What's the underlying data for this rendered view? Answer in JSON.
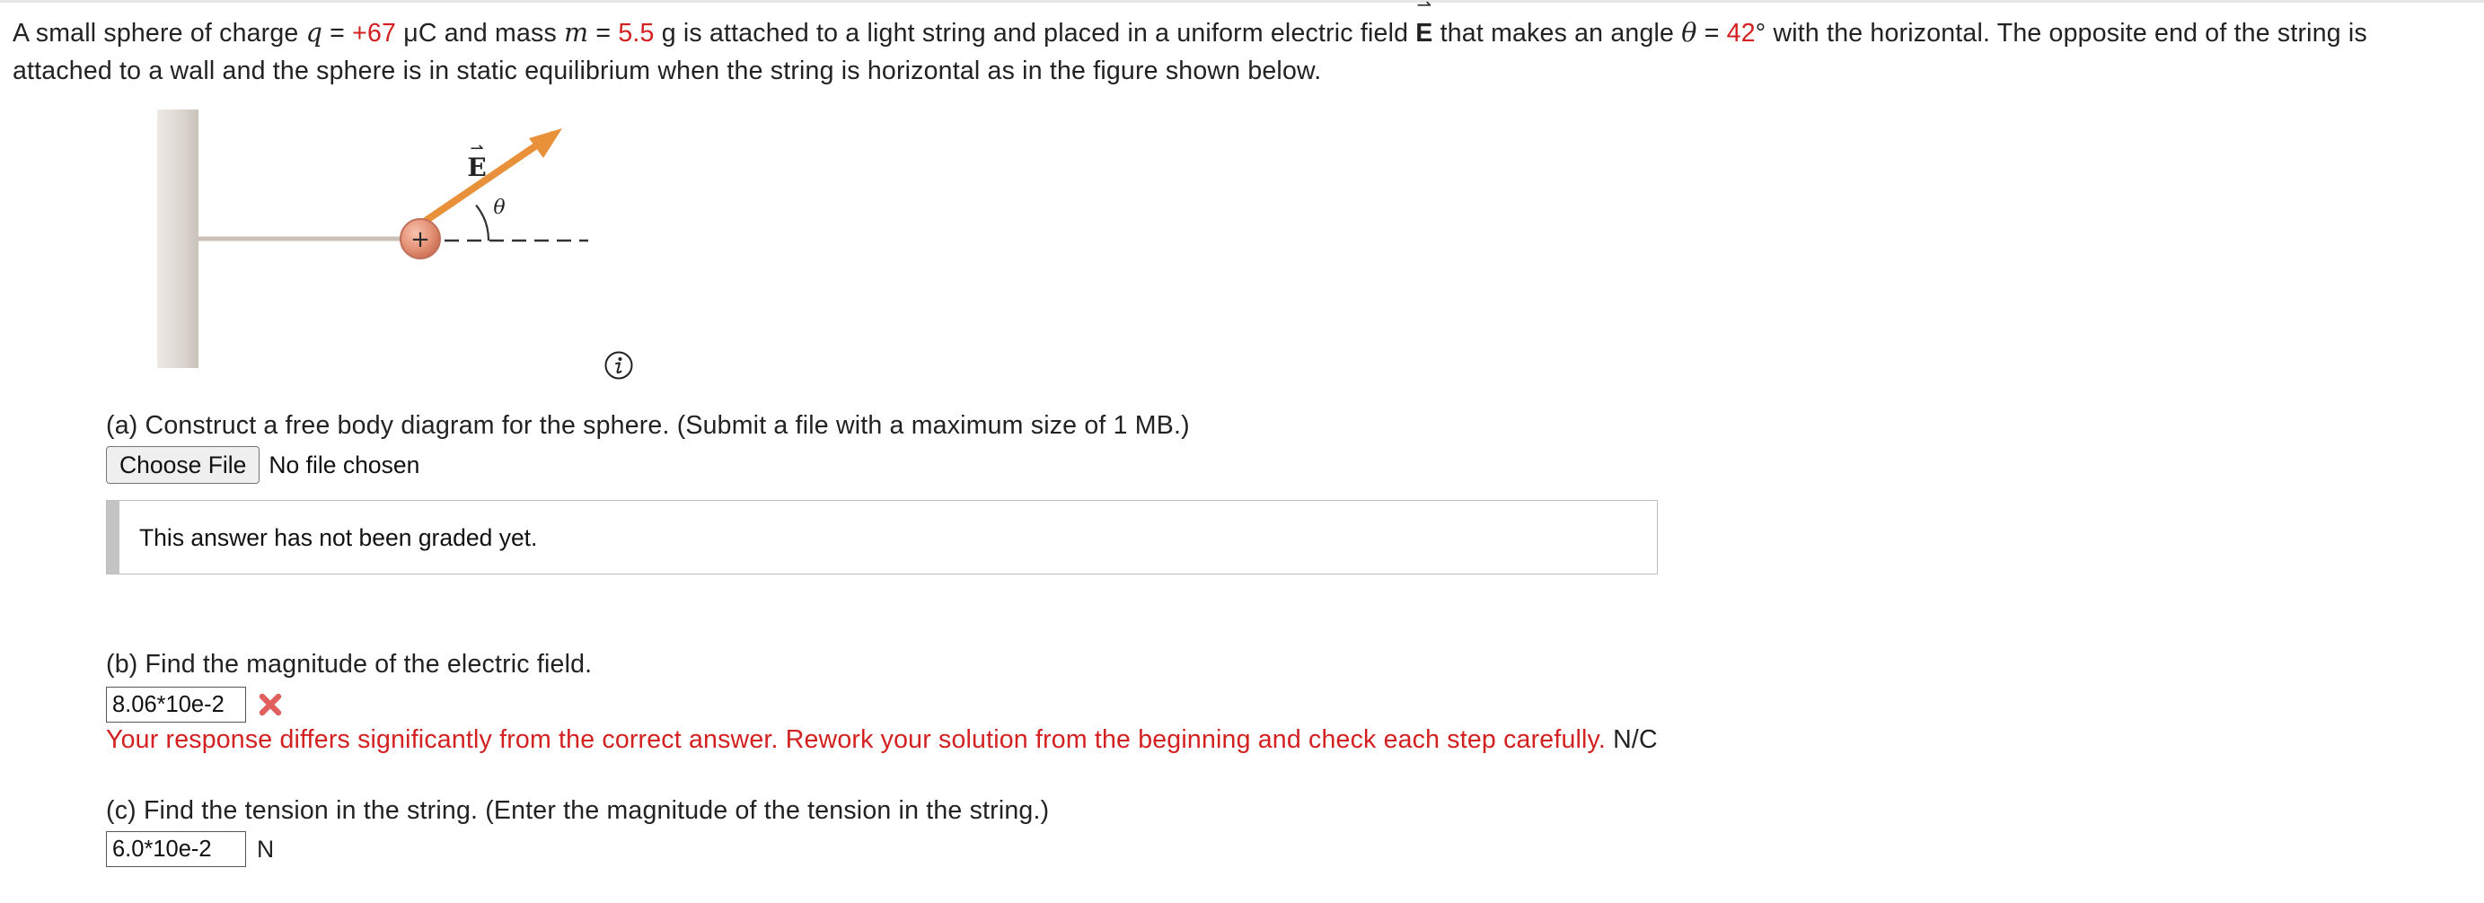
{
  "colors": {
    "given_value": "#d32020",
    "error_text": "#d32020",
    "wrong_mark": "#e06060",
    "field_arrow": "#e8913a",
    "sphere": "#e0896e",
    "wall": "#d8d2cc",
    "string": "#c9bdb5"
  },
  "problem": {
    "s1": "A small sphere of charge ",
    "q_symbol": "q",
    "s2": " = ",
    "q_value": "+67",
    "s3": " μC and mass ",
    "m_symbol": "m",
    "s4": " = ",
    "m_value": "5.5",
    "s5": " g is attached to a light string and placed in a uniform electric field ",
    "e_symbol": "E",
    "e_arrow": "⇀",
    "s6": " that makes an angle ",
    "theta_symbol": "θ",
    "s7": " = ",
    "theta_value": "42",
    "s8": "° with the horizontal. The opposite end of the string is attached to a wall and the sphere is in static equilibrium when the string is horizontal as in the figure shown below."
  },
  "figure": {
    "e_label": "E",
    "e_label_arrow": "⇀",
    "theta_label": "θ",
    "plus_sign": "+",
    "info_icon": "info-icon",
    "angle_deg": 42
  },
  "part_a": {
    "prompt": "(a) Construct a free body diagram for the sphere. (Submit a file with a maximum size of 1 MB.)",
    "choose_file_label": "Choose File",
    "file_status": "No file chosen",
    "graded_message": "This answer has not been graded yet."
  },
  "part_b": {
    "prompt": "(b) Find the magnitude of the electric field.",
    "answer_value": "8.06*10e-2",
    "status_icon": "wrong-x-icon",
    "feedback": "Your response differs significantly from the correct answer. Rework your solution from the beginning and check each step carefully.",
    "unit": "N/C"
  },
  "part_c": {
    "prompt": "(c) Find the tension in the string. (Enter the magnitude of the tension in the string.)",
    "answer_value": "6.0*10e-2",
    "unit": "N"
  }
}
